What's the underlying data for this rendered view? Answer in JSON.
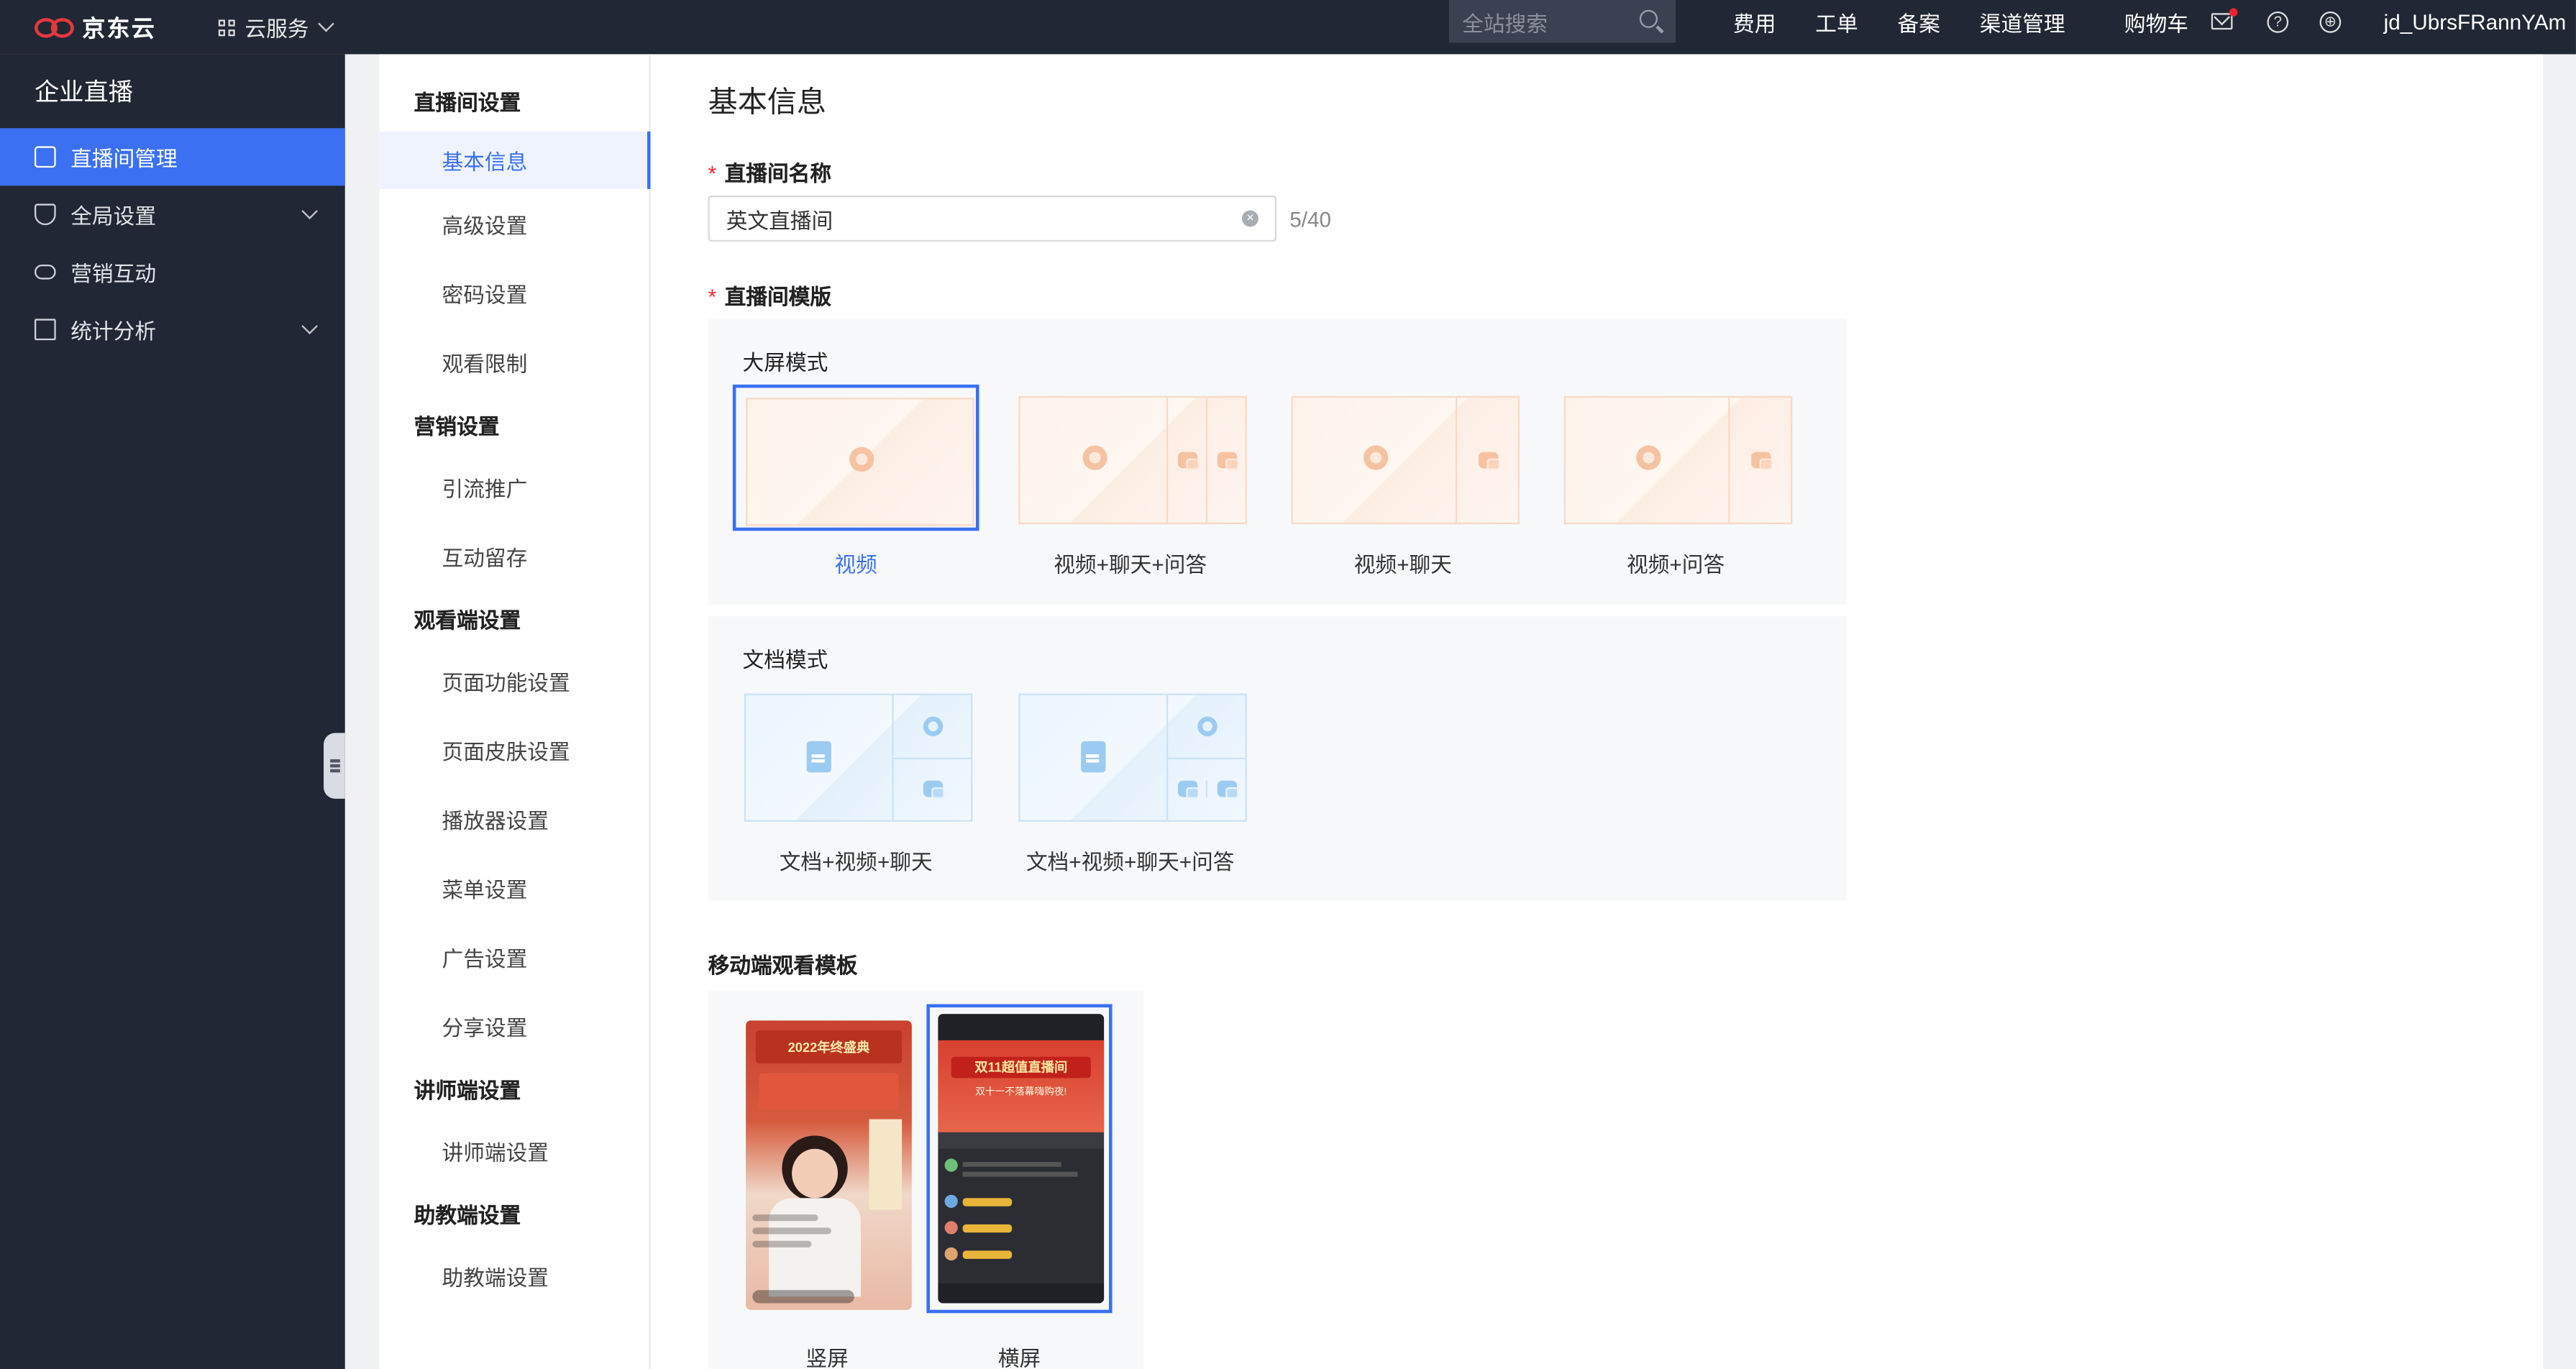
{
  "topbar": {
    "logo_text": "京东云",
    "cloud_services": "云服务",
    "search_placeholder": "全站搜索",
    "links": [
      "费用",
      "工单",
      "备案",
      "渠道管理"
    ],
    "cart": "购物车",
    "help_symbol": "?",
    "user": "jd_UbrsFRannYAm"
  },
  "leftnav": {
    "title": "企业直播",
    "items": [
      {
        "label": "直播间管理",
        "icon": "layout-icon",
        "active": true
      },
      {
        "label": "全局设置",
        "icon": "shield-icon",
        "expandable": true
      },
      {
        "label": "营销互动",
        "icon": "cloud-icon"
      },
      {
        "label": "统计分析",
        "icon": "doc-icon",
        "expandable": true
      }
    ]
  },
  "subnav": {
    "groups": [
      {
        "title": "直播间设置",
        "items": [
          "基本信息",
          "高级设置",
          "密码设置",
          "观看限制"
        ]
      },
      {
        "title": "营销设置",
        "items": [
          "引流推广",
          "互动留存"
        ]
      },
      {
        "title": "观看端设置",
        "items": [
          "页面功能设置",
          "页面皮肤设置",
          "播放器设置",
          "菜单设置",
          "广告设置",
          "分享设置"
        ]
      },
      {
        "title": "讲师端设置",
        "items": [
          "讲师端设置"
        ]
      },
      {
        "title": "助教端设置",
        "items": [
          "助教端设置"
        ]
      }
    ],
    "active": "基本信息"
  },
  "main": {
    "title": "基本信息",
    "room_name_label": "直播间名称",
    "room_name_value": "英文直播间",
    "room_name_counter": "5/40",
    "clear_symbol": "×",
    "template_label": "直播间模版",
    "big_screen": {
      "title": "大屏模式",
      "templates": [
        "视频",
        "视频+聊天+问答",
        "视频+聊天",
        "视频+问答"
      ],
      "selected": "视频"
    },
    "doc_mode": {
      "title": "文档模式",
      "templates": [
        "文档+视频+聊天",
        "文档+视频+聊天+问答"
      ]
    },
    "mobile": {
      "title": "移动端观看模板",
      "templates": [
        "竖屏",
        "横屏"
      ],
      "selected": "横屏",
      "portrait_banner": "2022年终盛典",
      "landscape_banner": "双11超值直播间",
      "landscape_sub": "双十一不落幕嗨购夜!"
    }
  },
  "colors": {
    "accent": "#3a70f1",
    "nav_bg": "#222735",
    "required": "#f5222d"
  }
}
